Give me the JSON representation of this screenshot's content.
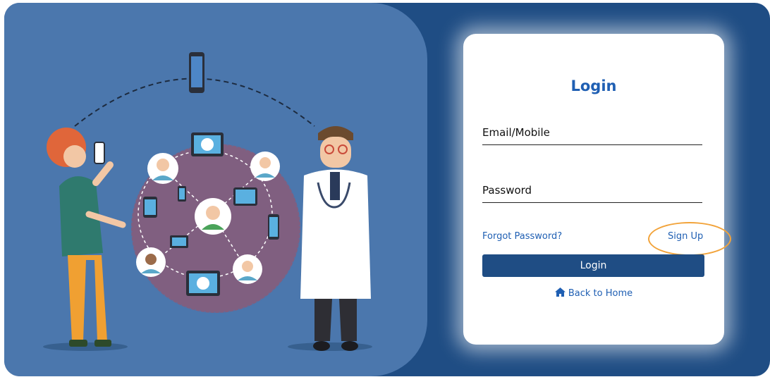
{
  "login": {
    "title": "Login",
    "email_label": "Email/Mobile",
    "password_label": "Password",
    "forgot_password": "Forgot Password?",
    "sign_up": "Sign Up",
    "login_button": "Login",
    "back_to_home": "Back to Home"
  },
  "colors": {
    "left_panel": "#4b77ad",
    "page_background": "#1f4d84",
    "button": "#1f4d84",
    "link": "#1f5fb3",
    "highlight_ring": "#f2a33a"
  },
  "icons": {
    "back_to_home": "home-icon"
  }
}
